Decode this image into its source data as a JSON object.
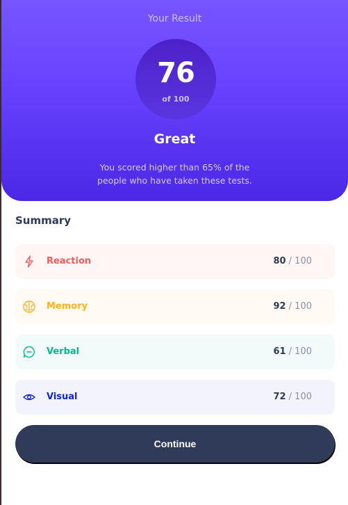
{
  "result": {
    "title": "Your Result",
    "score": "76",
    "of_label": "of 100",
    "label": "Great",
    "description": "You scored higher than 65% of the people who have taken these tests."
  },
  "summary": {
    "title": "Summary",
    "items": [
      {
        "label": "Reaction",
        "score": "80",
        "max": " / 100",
        "icon": "lightning-icon",
        "color": "#f55b5b",
        "bg": "#fff6f5"
      },
      {
        "label": "Memory",
        "score": "92",
        "max": " / 100",
        "icon": "brain-icon",
        "color": "#ffb21e",
        "bg": "#fffbf4"
      },
      {
        "label": "Verbal",
        "score": "61",
        "max": " / 100",
        "icon": "chat-icon",
        "color": "#00bb8f",
        "bg": "#f2fbfa"
      },
      {
        "label": "Visual",
        "score": "72",
        "max": " / 100",
        "icon": "eye-icon",
        "color": "#1125d6",
        "bg": "#f3f3fd"
      }
    ]
  },
  "continue_label": "Continue"
}
